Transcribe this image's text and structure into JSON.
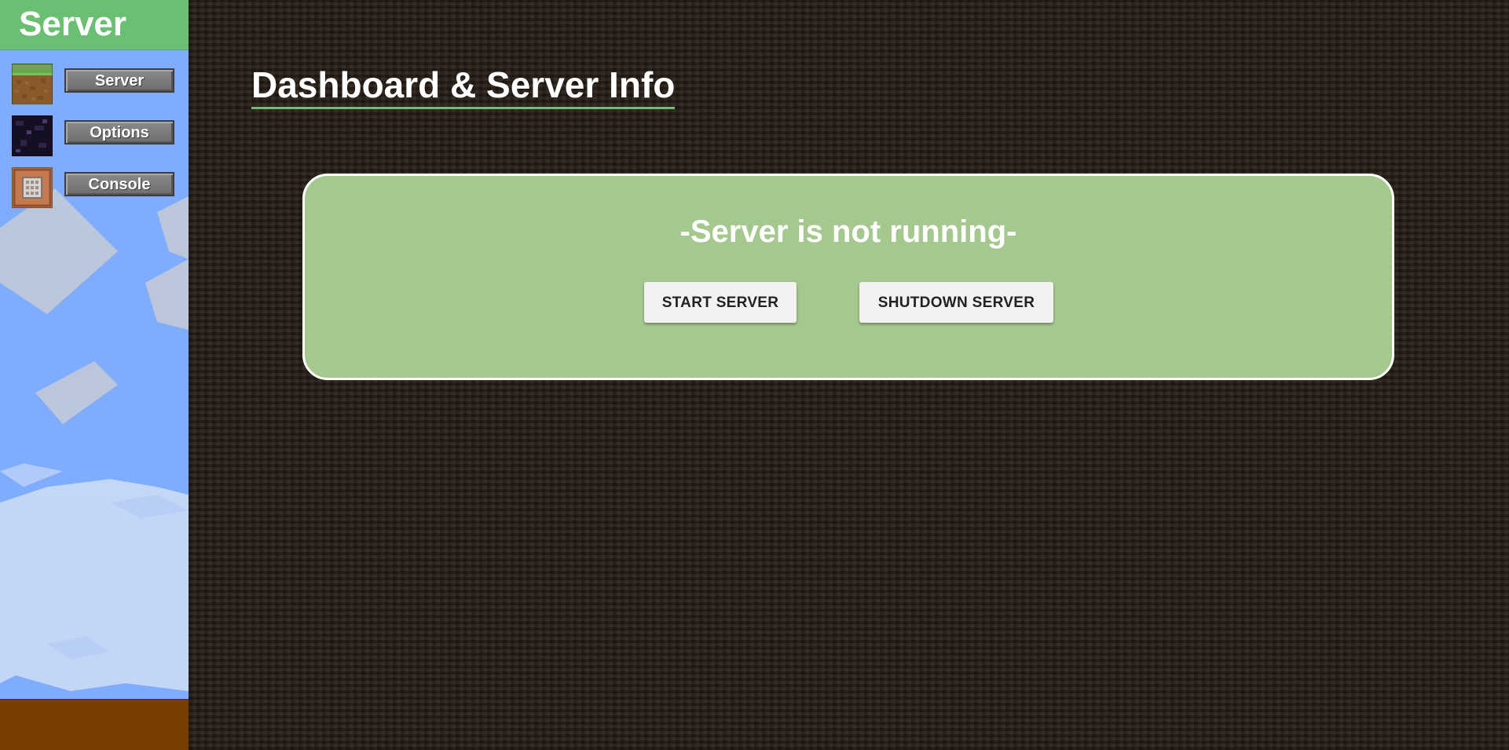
{
  "sidebar": {
    "title": "Server",
    "items": [
      {
        "label": "Server",
        "icon": "grass-block-icon"
      },
      {
        "label": "Options",
        "icon": "obsidian-block-icon"
      },
      {
        "label": "Console",
        "icon": "command-block-icon"
      }
    ]
  },
  "main": {
    "title": "Dashboard & Server Info",
    "status": {
      "message": "-Server is not running-",
      "buttons": {
        "start": "START SERVER",
        "shutdown": "SHUTDOWN SERVER"
      }
    }
  },
  "colors": {
    "accent_green": "#6bbf72",
    "card_green": "#a5c88f",
    "sky_blue": "#7facfc",
    "dirt_bg": "#2b2119",
    "footer_brown": "#7a3f00"
  }
}
